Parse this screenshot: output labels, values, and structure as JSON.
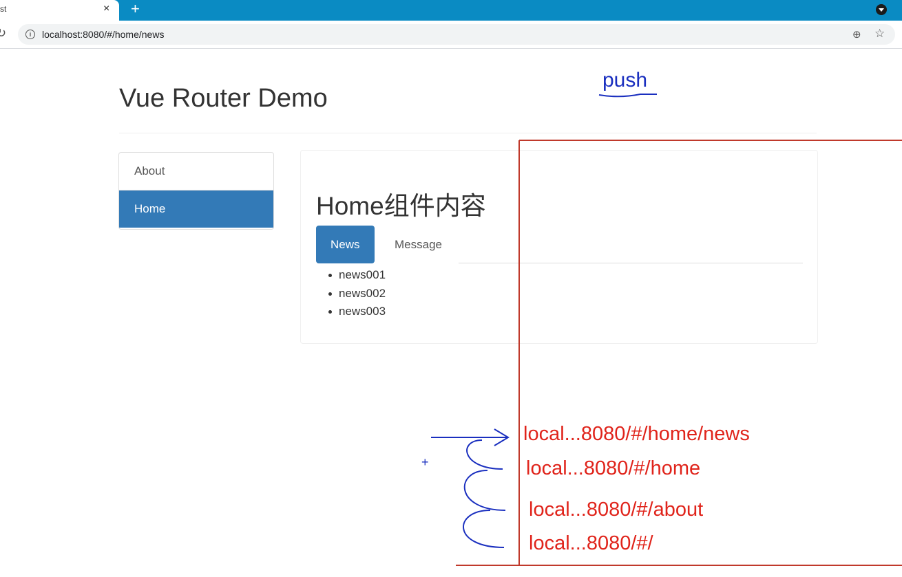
{
  "browser": {
    "tab_title": "st",
    "tab_close": "×",
    "new_tab": "+",
    "url": "localhost:8080/#/home/news",
    "icons": [
      "reload-icon",
      "info-icon",
      "zoom-icon",
      "star-icon",
      "menu-icon"
    ]
  },
  "page": {
    "title": "Vue Router Demo",
    "sidebar": {
      "items": [
        {
          "label": "About",
          "active": false
        },
        {
          "label": "Home",
          "active": true
        }
      ]
    },
    "home": {
      "title": "Home组件内容",
      "tabs": [
        {
          "label": "News",
          "active": true
        },
        {
          "label": "Message",
          "active": false
        }
      ],
      "news": [
        "news001",
        "news002",
        "news003"
      ]
    }
  },
  "annotations": {
    "push_label": "push",
    "history_stack": [
      "local...8080/#/home/news",
      "local...8080/#/home",
      "local...8080/#/about",
      "local...8080/#/"
    ],
    "plus_mark": "+",
    "colors": {
      "stack": "#e0241b",
      "pen": "#1a2fbf",
      "active": "#337ab7"
    }
  }
}
